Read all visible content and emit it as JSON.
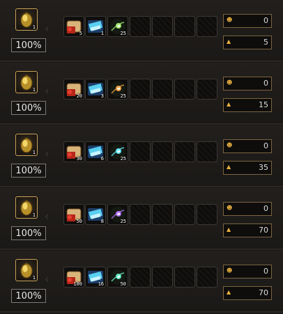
{
  "rows": [
    {
      "result_count": "1",
      "rate": "100%",
      "items": [
        {
          "icon": "scroll-red-icon",
          "count": "5"
        },
        {
          "icon": "scroll-blue-icon",
          "count": "1"
        },
        {
          "icon": "orb-green-icon",
          "count": "25"
        }
      ],
      "cost1": "0",
      "cost2": "5"
    },
    {
      "result_count": "1",
      "rate": "100%",
      "items": [
        {
          "icon": "scroll-red-icon",
          "count": "20"
        },
        {
          "icon": "scroll-blue-icon",
          "count": "3"
        },
        {
          "icon": "orb-orange-icon",
          "count": "25"
        }
      ],
      "cost1": "0",
      "cost2": "15"
    },
    {
      "result_count": "1",
      "rate": "100%",
      "items": [
        {
          "icon": "scroll-red-icon",
          "count": "30"
        },
        {
          "icon": "scroll-blue-icon",
          "count": "6"
        },
        {
          "icon": "orb-cyan-icon",
          "count": "25"
        }
      ],
      "cost1": "0",
      "cost2": "35"
    },
    {
      "result_count": "1",
      "rate": "100%",
      "items": [
        {
          "icon": "scroll-red-icon",
          "count": "50"
        },
        {
          "icon": "scroll-blue-icon",
          "count": "8"
        },
        {
          "icon": "orb-purple-icon",
          "count": "25"
        }
      ],
      "cost1": "0",
      "cost2": "70"
    },
    {
      "result_count": "1",
      "rate": "100%",
      "items": [
        {
          "icon": "scroll-red-icon",
          "count": "100"
        },
        {
          "icon": "scroll-blue-icon",
          "count": "16"
        },
        {
          "icon": "orb-teal-icon",
          "count": "50"
        }
      ],
      "cost1": "0",
      "cost2": "70"
    }
  ],
  "result_icon": "gold-gem-icon",
  "arrow_icon": "chevron-left-icon",
  "cost1_icon": "gold-coin-icon",
  "cost2_icon": "honor-point-icon",
  "colors": {
    "slot_border": "#c9a25a",
    "cost_border": "#7a6440",
    "rate_border": "#7d7a76"
  }
}
